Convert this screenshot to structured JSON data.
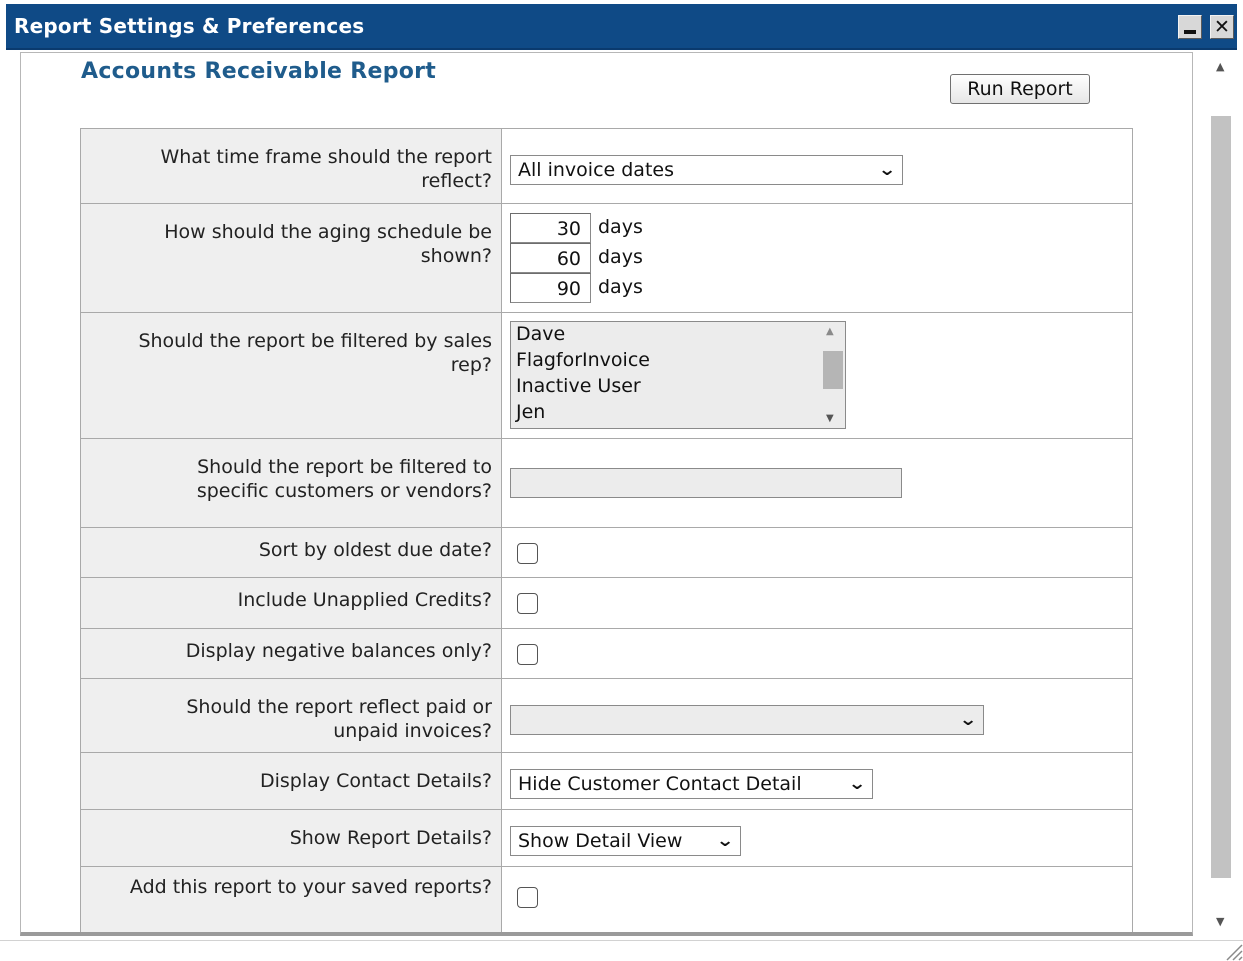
{
  "window": {
    "title": "Report Settings & Preferences",
    "minimize_icon": "minimize-icon",
    "close_icon": "close-icon",
    "close_glyph": "✕"
  },
  "report": {
    "title": "Accounts Receivable Report",
    "run_button": "Run Report"
  },
  "rows": {
    "time_frame": {
      "label": "What time frame should the report reflect?",
      "value": "All invoice dates"
    },
    "aging": {
      "label": "How should the aging schedule be shown?",
      "buckets": [
        "30",
        "60",
        "90"
      ],
      "unit": "days"
    },
    "sales_rep": {
      "label": "Should the report be filtered by sales rep?",
      "options": [
        "Dave",
        "FlagforInvoice",
        "Inactive User",
        "Jen"
      ]
    },
    "customers": {
      "label": "Should the report be filtered to specific customers or vendors?",
      "value": ""
    },
    "sort_oldest": {
      "label": "Sort by oldest due date?",
      "checked": false
    },
    "unapplied_credits": {
      "label": "Include Unapplied Credits?",
      "checked": false
    },
    "negative_only": {
      "label": "Display negative balances only?",
      "checked": false
    },
    "paid_unpaid": {
      "label": "Should the report reflect paid or unpaid invoices?",
      "value": ""
    },
    "contact_details": {
      "label": "Display Contact Details?",
      "value": "Hide Customer Contact Detail"
    },
    "report_details": {
      "label": "Show Report Details?",
      "value": "Show Detail View"
    },
    "saved_reports": {
      "label": "Add this report to your saved reports?",
      "checked": false
    }
  },
  "icons": {
    "dropdown": "chevron-down-icon",
    "scroll_up": "scroll-up-arrow-icon",
    "scroll_down": "scroll-down-arrow-icon",
    "resize_grip": "resize-grip-icon"
  },
  "colors": {
    "titlebar": "#0f4a86",
    "report_title": "#1f5c8c",
    "label_cell_bg": "#efefef"
  }
}
